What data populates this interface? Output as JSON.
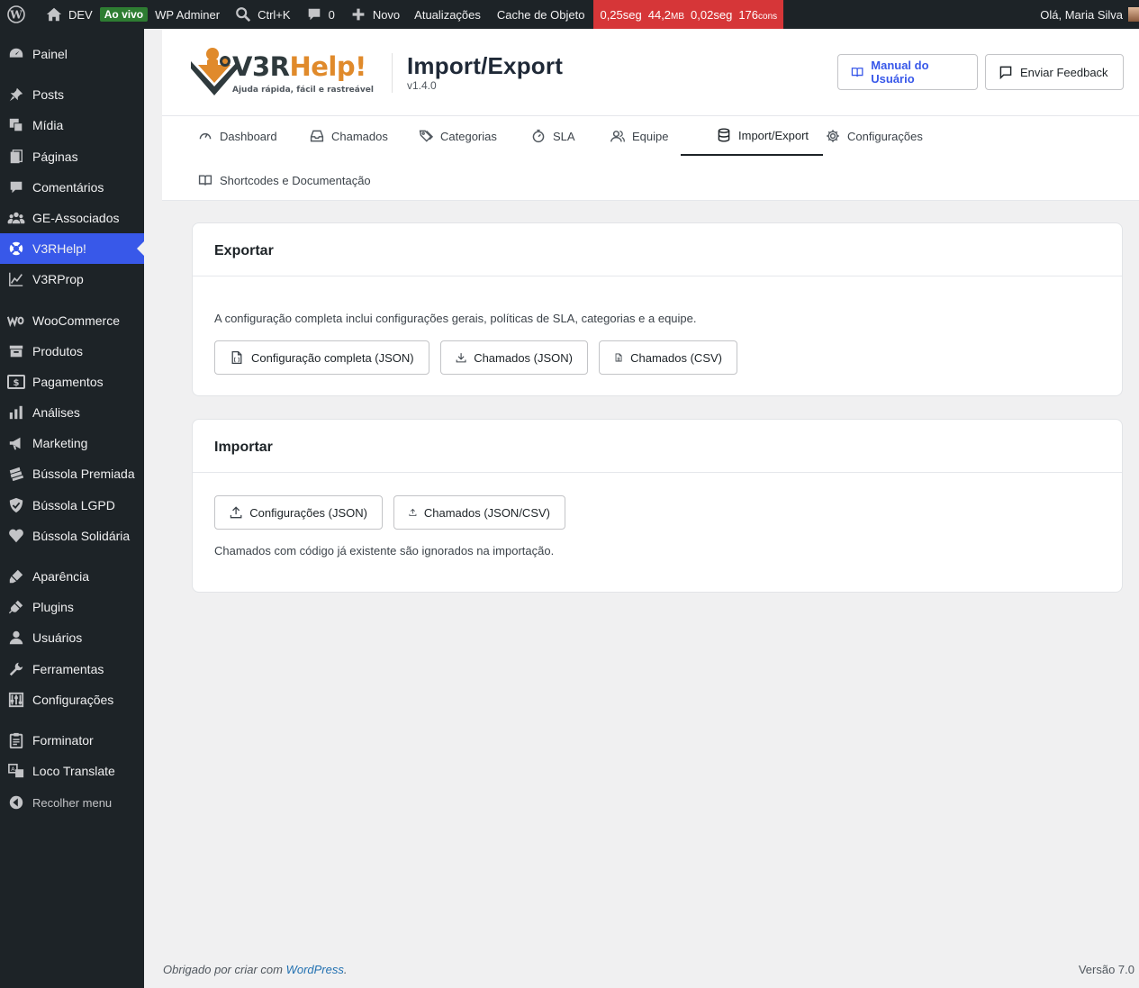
{
  "adminbar": {
    "site_name": "DEV",
    "live_badge": "Ao vivo",
    "wp_adminer": "WP Adminer",
    "search_shortcut": "Ctrl+K",
    "comments_count": "0",
    "new_label": "Novo",
    "updates_label": "Atualizações",
    "cache_label": "Cache de Objeto",
    "perf_time": "0,25seg",
    "perf_memory": "44,2",
    "perf_memory_unit": "MB",
    "perf_query_time": "0,02seg",
    "perf_queries": "176",
    "perf_queries_unit": "cons",
    "greeting": "Olá, Maria Silva"
  },
  "sidebar": {
    "items": [
      {
        "label": "Painel",
        "icon": "dashboard-icon"
      },
      {
        "label": "Posts",
        "icon": "pin-icon"
      },
      {
        "label": "Mídia",
        "icon": "media-icon"
      },
      {
        "label": "Páginas",
        "icon": "pages-icon"
      },
      {
        "label": "Comentários",
        "icon": "comments-icon"
      },
      {
        "label": "GE-Associados",
        "icon": "groups-icon"
      },
      {
        "label": "V3RHelp!",
        "icon": "lifebuoy-icon"
      },
      {
        "label": "V3RProp",
        "icon": "chart-line-icon"
      },
      {
        "label": "WooCommerce",
        "icon": "woo-icon"
      },
      {
        "label": "Produtos",
        "icon": "archive-icon"
      },
      {
        "label": "Pagamentos",
        "icon": "money-icon"
      },
      {
        "label": "Análises",
        "icon": "bar-chart-icon"
      },
      {
        "label": "Marketing",
        "icon": "megaphone-icon"
      },
      {
        "label": "Bússola Premiada",
        "icon": "tickets-icon"
      },
      {
        "label": "Bússola LGPD",
        "icon": "shield-icon"
      },
      {
        "label": "Bússola Solidária",
        "icon": "heart-icon"
      },
      {
        "label": "Aparência",
        "icon": "brush-icon"
      },
      {
        "label": "Plugins",
        "icon": "plug-icon"
      },
      {
        "label": "Usuários",
        "icon": "user-icon"
      },
      {
        "label": "Ferramentas",
        "icon": "wrench-icon"
      },
      {
        "label": "Configurações",
        "icon": "sliders-icon"
      },
      {
        "label": "Forminator",
        "icon": "clipboard-icon"
      },
      {
        "label": "Loco Translate",
        "icon": "translate-icon"
      }
    ],
    "collapse_label": "Recolher menu"
  },
  "header": {
    "logo_text_main": "V3R",
    "logo_text_accent": "Help!",
    "logo_tagline": "Ajuda rápida, fácil e rastreável",
    "title": "Import/Export",
    "version": "v1.4.0",
    "manual_label": "Manual do Usuário",
    "feedback_label": "Enviar Feedback",
    "accent_color": "#3858e9",
    "brand_orange": "#e08a2b"
  },
  "tabs": [
    {
      "label": "Dashboard",
      "icon": "gauge-icon"
    },
    {
      "label": "Chamados",
      "icon": "inbox-icon"
    },
    {
      "label": "Categorias",
      "icon": "tags-icon"
    },
    {
      "label": "SLA",
      "icon": "timer-icon"
    },
    {
      "label": "Equipe",
      "icon": "users-icon"
    },
    {
      "label": "Import/Export",
      "icon": "database-icon",
      "active": true
    },
    {
      "label": "Configurações",
      "icon": "gear-icon"
    },
    {
      "label": "Shortcodes e Documentação",
      "icon": "book-icon"
    }
  ],
  "export_card": {
    "title": "Exportar",
    "description": "A configuração completa inclui configurações gerais, políticas de SLA, categorias e a equipe.",
    "buttons": [
      "Configuração completa (JSON)",
      "Chamados (JSON)",
      "Chamados (CSV)"
    ]
  },
  "import_card": {
    "title": "Importar",
    "buttons": [
      "Configurações (JSON)",
      "Chamados (JSON/CSV)"
    ],
    "note": "Chamados com código já existente são ignorados na importação."
  },
  "footer": {
    "thanks_prefix": "Obrigado por criar com ",
    "thanks_link": "WordPress",
    "thanks_suffix": ".",
    "version": "Versão 7.0"
  }
}
